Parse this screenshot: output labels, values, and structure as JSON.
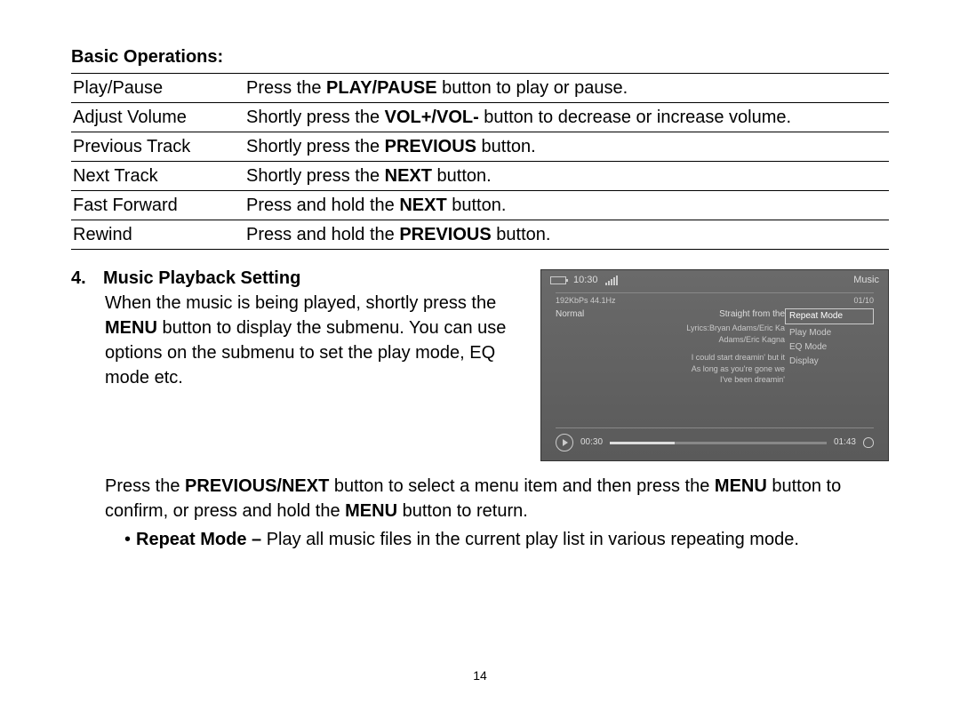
{
  "header": "Basic Operations:",
  "ops": [
    {
      "name": "Play/Pause",
      "desc_pre": "Press the ",
      "desc_bold": "PLAY/PAUSE",
      "desc_post": " button to play or pause."
    },
    {
      "name": "Adjust Volume",
      "desc_pre": "Shortly press the ",
      "desc_bold": "VOL+/VOL-",
      "desc_post": " button to decrease or increase volume."
    },
    {
      "name": "Previous Track",
      "desc_pre": "Shortly press the ",
      "desc_bold": "PREVIOUS",
      "desc_post": " button."
    },
    {
      "name": "Next Track",
      "desc_pre": "Shortly press the ",
      "desc_bold": "NEXT",
      "desc_post": " button."
    },
    {
      "name": "Fast Forward",
      "desc_pre": "Press and hold the ",
      "desc_bold": "NEXT",
      "desc_post": " button."
    },
    {
      "name": "Rewind",
      "desc_pre": "Press and hold the ",
      "desc_bold": "PREVIOUS",
      "desc_post": " button."
    }
  ],
  "section": {
    "num": "4.",
    "title": "Music Playback Setting",
    "para1_a": "When the music is being played, shortly press the ",
    "para1_b": "MENU",
    "para1_c": " button to display the submenu. You can use options on the submenu to set the play mode, EQ mode etc.",
    "para2_a": "Press the ",
    "para2_b": "PREVIOUS/NEXT",
    "para2_c": " button to select a menu item and then press the ",
    "para2_d": "MENU",
    "para2_e": " button to confirm, or press and hold the ",
    "para2_f": "MENU",
    "para2_g": " button to return.",
    "bullet_label": "Repeat Mode – ",
    "bullet_text": "Play all music files in the current play list in various repeating mode."
  },
  "screenshot": {
    "time": "10:30",
    "app": "Music",
    "bitrate": "192KbPs 44.1Hz",
    "track_idx": "01/10",
    "eq": "Normal",
    "title": "Straight from the",
    "lyrics1": "Lyrics:Bryan Adams/Eric Ka",
    "lyrics2": "Adams/Eric Kagna",
    "lyrics3": "I could start dreamin' but it",
    "lyrics4": "As long as you're gone we",
    "lyrics5": "I've been dreamin'",
    "menu": [
      "Repeat Mode",
      "Play Mode",
      "EQ Mode",
      "Display"
    ],
    "elapsed": "00:30",
    "total": "01:43"
  },
  "page": "14"
}
